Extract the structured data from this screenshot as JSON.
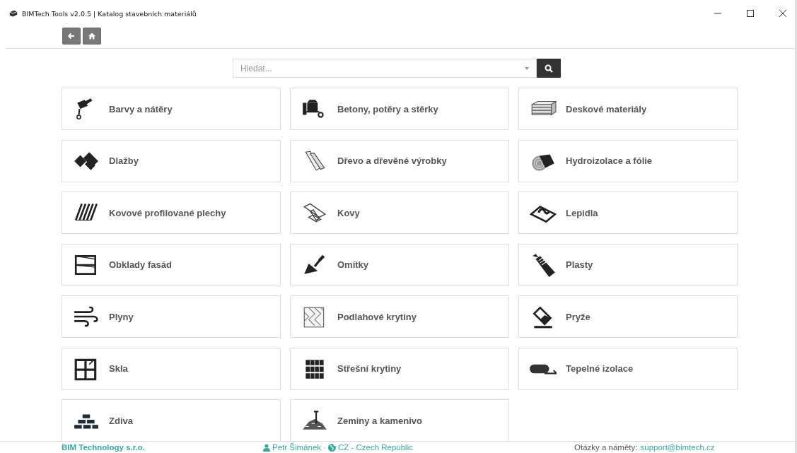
{
  "window": {
    "title": "BIMTech Tools v2.0.5 | Katalog stavebních materiálů"
  },
  "search": {
    "placeholder": "Hledat..."
  },
  "categories": [
    {
      "label": "Barvy a nátěry",
      "kind": "brush"
    },
    {
      "label": "Betony, potěry a stěrky",
      "kind": "mixer"
    },
    {
      "label": "Deskové materiály",
      "kind": "boards"
    },
    {
      "label": "Dlažby",
      "kind": "tiles"
    },
    {
      "label": "Dřevo a dřevěné výrobky",
      "kind": "planks"
    },
    {
      "label": "Hydroizolace a fólie",
      "kind": "roll"
    },
    {
      "label": "Kovové profilované plechy",
      "kind": "sheets"
    },
    {
      "label": "Kovy",
      "kind": "beam"
    },
    {
      "label": "Lepidla",
      "kind": "trowel"
    },
    {
      "label": "Obklady fasád",
      "kind": "facade"
    },
    {
      "label": "Omítky",
      "kind": "spatula"
    },
    {
      "label": "Plasty",
      "kind": "bottle"
    },
    {
      "label": "Plyny",
      "kind": "wind"
    },
    {
      "label": "Podlahové krytiny",
      "kind": "parquet"
    },
    {
      "label": "Pryže",
      "kind": "eraser"
    },
    {
      "label": "Skla",
      "kind": "window"
    },
    {
      "label": "Střešní krytiny",
      "kind": "rooftiles"
    },
    {
      "label": "Tepelné izolace",
      "kind": "insulation"
    },
    {
      "label": "Zdiva",
      "kind": "bricks"
    },
    {
      "label": "Zeminy a kamenivo",
      "kind": "soil"
    }
  ],
  "footer": {
    "company": "BIM Technology s.r.o.",
    "author": "Petr Šimánek",
    "separator": "·",
    "country": "CZ - Czech Republic",
    "contact_label": "Otázky a náměty:",
    "contact_email": "support@bimtech.cz"
  }
}
